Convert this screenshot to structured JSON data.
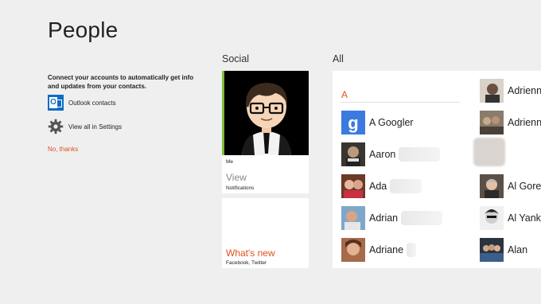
{
  "page": {
    "title": "People"
  },
  "sidebar": {
    "connect_text": "Connect your accounts to automatically get info and updates from your contacts.",
    "outlook_label": "Outlook contacts",
    "settings_label": "View all in Settings",
    "no_thanks_label": "No, thanks",
    "colors": {
      "accent": "#e0501f",
      "outlook_blue": "#0f6cc3"
    }
  },
  "social": {
    "heading": "Social",
    "me_tile": {
      "label": "Me",
      "action": "View",
      "sub": "Notifications",
      "accent": "#7bbf3a"
    },
    "whats_new": {
      "label": "What's new",
      "sub": "Facebook, Twitter"
    }
  },
  "all": {
    "heading": "All",
    "letter": "A",
    "left_column": [
      {
        "name": "A Googler",
        "icon": "google-g-icon"
      },
      {
        "name": "Aaron"
      },
      {
        "name": "Ada"
      },
      {
        "name": "Adrian"
      },
      {
        "name": "Adriane"
      }
    ],
    "right_column": [
      {
        "name": "Adrienn"
      },
      {
        "name": "Adrienn"
      },
      {
        "name": ""
      },
      {
        "name": "Al Gore"
      },
      {
        "name": "Al Yanko"
      },
      {
        "name": "Alan"
      }
    ]
  }
}
